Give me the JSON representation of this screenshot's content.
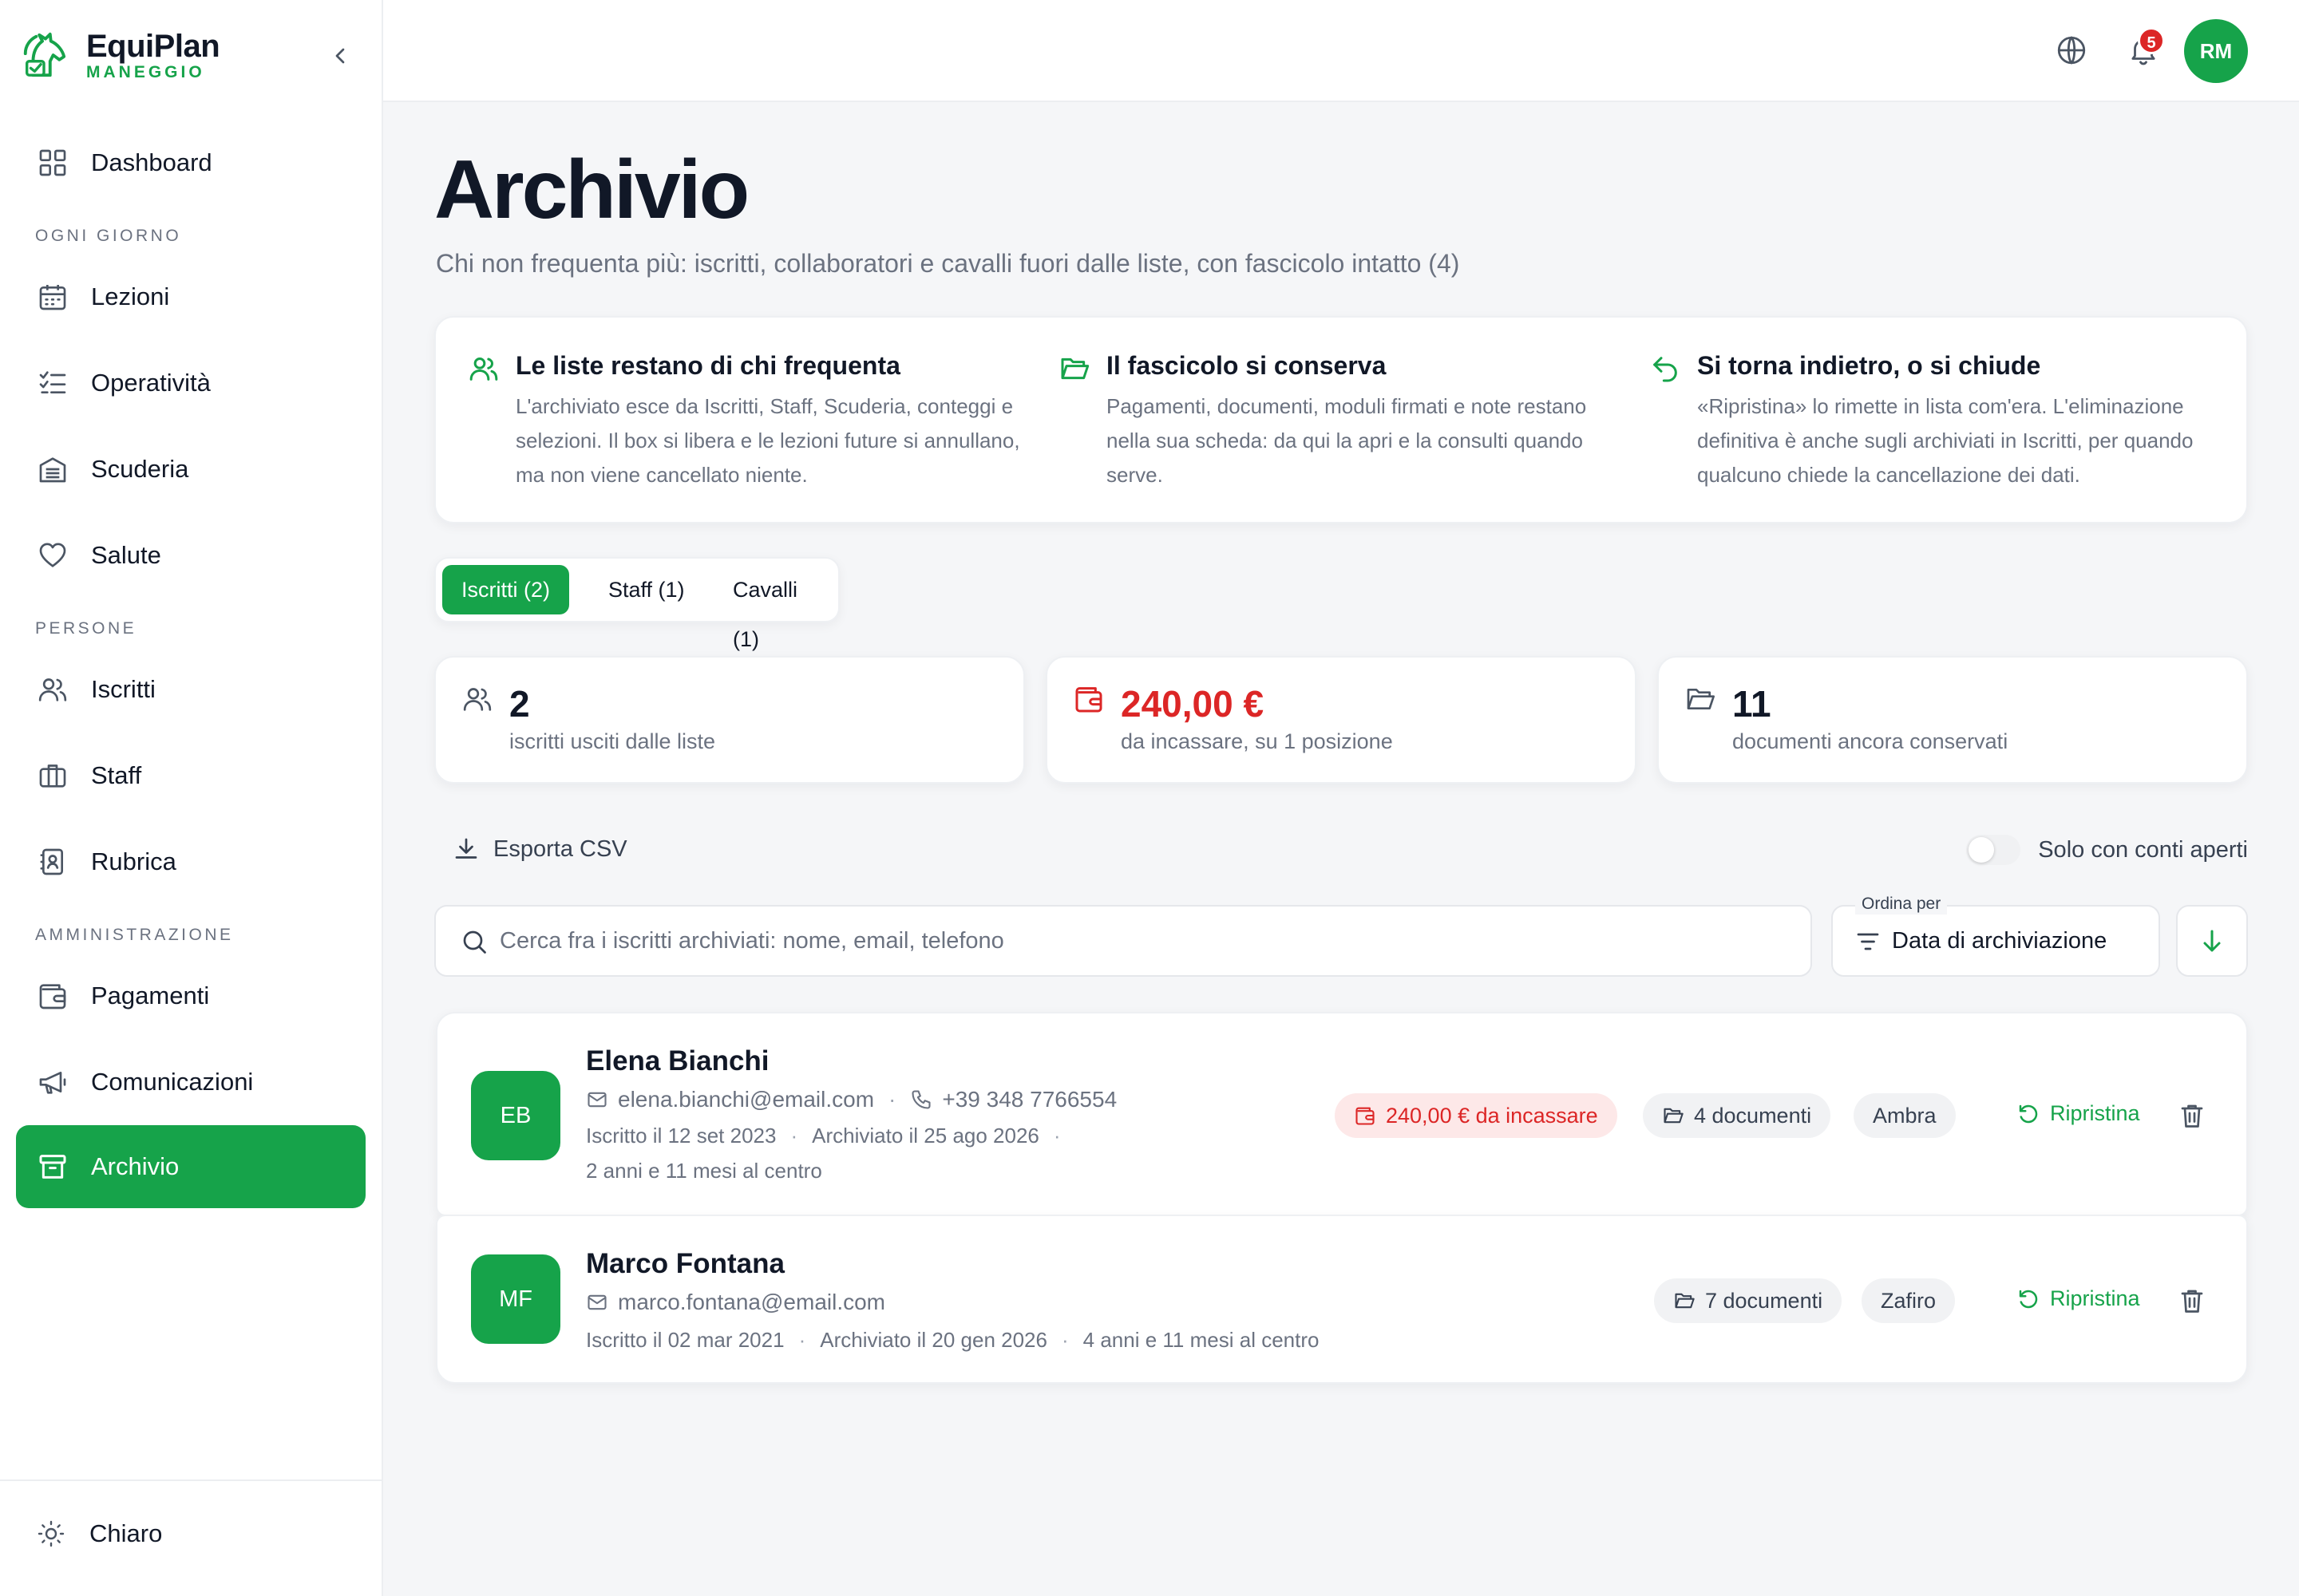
{
  "brand": {
    "name": "EquiPlan",
    "sub": "MANEGGIO"
  },
  "sidebar": {
    "dashboard": "Dashboard",
    "sections": {
      "daily": "OGNI GIORNO",
      "people": "PERSONE",
      "admin": "AMMINISTRAZIONE"
    },
    "items": {
      "lezioni": "Lezioni",
      "operativita": "Operatività",
      "scuderia": "Scuderia",
      "salute": "Salute",
      "iscritti": "Iscritti",
      "staff": "Staff",
      "rubrica": "Rubrica",
      "pagamenti": "Pagamenti",
      "comunicazioni": "Comunicazioni",
      "archivio": "Archivio"
    },
    "theme_label": "Chiaro"
  },
  "topbar": {
    "notifications_count": "5",
    "avatar_initials": "RM"
  },
  "page": {
    "title": "Archivio",
    "subtitle": "Chi non frequenta più: iscritti, collaboratori e cavalli fuori dalle liste, con fascicolo intatto (4)"
  },
  "info": [
    {
      "title": "Le liste restano di chi frequenta",
      "text": "L'archiviato esce da Iscritti, Staff, Scuderia, conteggi e selezioni. Il box si libera e le lezioni future si annullano, ma non viene cancellato niente."
    },
    {
      "title": "Il fascicolo si conserva",
      "text": "Pagamenti, documenti, moduli firmati e note restano nella sua scheda: da qui la apri e la consulti quando serve."
    },
    {
      "title": "Si torna indietro, o si chiude",
      "text": "«Ripristina» lo rimette in lista com'era. L'eliminazione definitiva è anche sugli archiviati in Iscritti, per quando qualcuno chiede la cancellazione dei dati."
    }
  ],
  "tabs": [
    {
      "label": "Iscritti (2)"
    },
    {
      "label": "Staff (1)"
    },
    {
      "label": "Cavalli (1)"
    }
  ],
  "stats": [
    {
      "value": "2",
      "label": "iscritti usciti dalle liste"
    },
    {
      "value": "240,00 €",
      "label": "da incassare, su 1 posizione"
    },
    {
      "value": "11",
      "label": "documenti ancora conservati"
    }
  ],
  "toolbar": {
    "export_label": "Esporta CSV",
    "toggle_label": "Solo con conti aperti",
    "search_placeholder": "Cerca fra i iscritti archiviati: nome, email, telefono",
    "sort_legend": "Ordina per",
    "sort_value": "Data di archiviazione"
  },
  "records": [
    {
      "initials": "EB",
      "name": "Elena Bianchi",
      "email": "elena.bianchi@email.com",
      "phone": "+39 348 7766554",
      "enrolled": "Iscritto il 12 set 2023",
      "archived": "Archiviato il 25 ago 2026",
      "duration": "2 anni e 11 mesi al centro",
      "balance": "240,00 € da incassare",
      "documents": "4 documenti",
      "horse": "Ambra",
      "restore_label": "Ripristina"
    },
    {
      "initials": "MF",
      "name": "Marco Fontana",
      "email": "marco.fontana@email.com",
      "enrolled": "Iscritto il 02 mar 2021",
      "archived": "Archiviato il 20 gen 2026",
      "duration": "4 anni e 11 mesi al centro",
      "documents": "7 documenti",
      "horse": "Zafiro",
      "restore_label": "Ripristina"
    }
  ],
  "colors": {
    "accent": "#16a34a",
    "danger": "#dc2626",
    "text": "#111827",
    "muted": "#6b7280",
    "background": "#f5f6f8"
  }
}
